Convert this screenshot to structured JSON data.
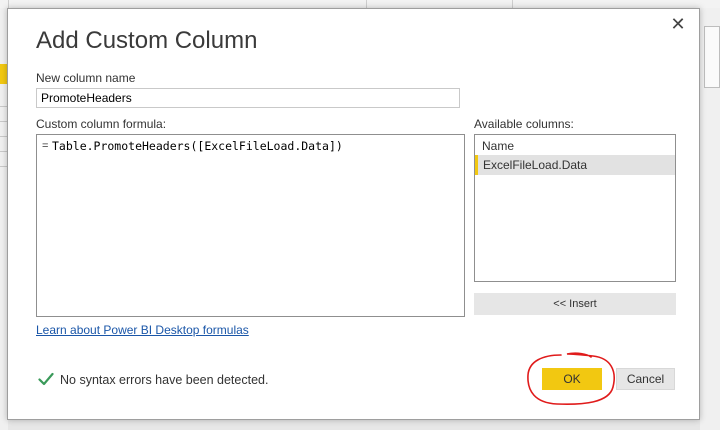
{
  "dialog": {
    "title": "Add Custom Column",
    "close_glyph": "✕"
  },
  "column_name": {
    "label": "New column name",
    "value": "PromoteHeaders"
  },
  "formula": {
    "label": "Custom column formula:",
    "prefix": "=",
    "text": "Table.PromoteHeaders([ExcelFileLoad.Data])"
  },
  "available": {
    "label": "Available columns:",
    "header": "Name",
    "items": [
      "ExcelFileLoad.Data"
    ],
    "insert_label": "<< Insert"
  },
  "help_link": "Learn about Power BI Desktop formulas",
  "status": {
    "text": "No syntax errors have been detected.",
    "icon": "check-icon",
    "color": "#3a9a5a"
  },
  "buttons": {
    "ok": "OK",
    "cancel": "Cancel"
  },
  "colors": {
    "accent": "#f2c811",
    "link": "#1a56a8",
    "annotation": "#e01b1b"
  }
}
